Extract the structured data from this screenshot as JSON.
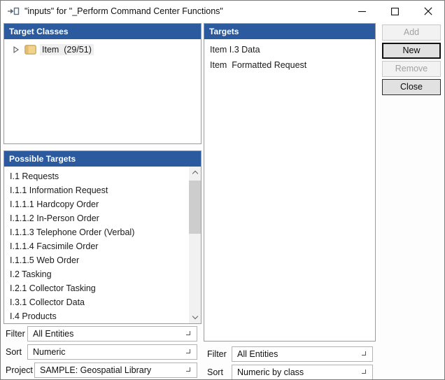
{
  "window": {
    "title": "\"inputs\" for \"_Perform Command Center Functions\"",
    "icons": {
      "app": "arrow-into-window-icon",
      "minimize": "minimize-icon",
      "maximize": "maximize-icon",
      "close": "close-icon",
      "tree_expander": "chevron-right-icon",
      "tree_node": "folder-icon",
      "combo": "chevron-down-icon",
      "scroll_up": "chevron-up-icon",
      "scroll_down": "chevron-down-icon"
    }
  },
  "colors": {
    "header_blue": "#2b5a9e",
    "folder_tan": "#f2d38c",
    "disabled_text": "#a2a2a2",
    "thumb_gray": "#cdcdcd"
  },
  "panels": {
    "target_classes": {
      "header": "Target Classes",
      "tree_item_label": "Item  (29/51)"
    },
    "targets": {
      "header": "Targets",
      "items": [
        "Item I.3 Data",
        "Item  Formatted Request"
      ]
    },
    "possible_targets": {
      "header": "Possible Targets",
      "items": [
        "I.1 Requests",
        "I.1.1 Information Request",
        "I.1.1.1 Hardcopy Order",
        "I.1.1.2 In-Person Order",
        "I.1.1.3 Telephone Order (Verbal)",
        "I.1.1.4 Facsimile Order",
        "I.1.1.5 Web Order",
        "I.2 Tasking",
        "I.2.1 Collector Tasking",
        "I.3.1 Collector Data",
        "I.4 Products"
      ]
    }
  },
  "buttons": {
    "add": "Add",
    "new": "New",
    "remove": "Remove",
    "close": "Close"
  },
  "left_controls": {
    "filter_label": "Filter",
    "filter_value": "All Entities",
    "sort_label": "Sort",
    "sort_value": "Numeric",
    "project_label": "Project",
    "project_value": "SAMPLE: Geospatial Library"
  },
  "right_controls": {
    "filter_label": "Filter",
    "filter_value": "All Entities",
    "sort_label": "Sort",
    "sort_value": "Numeric by class"
  }
}
